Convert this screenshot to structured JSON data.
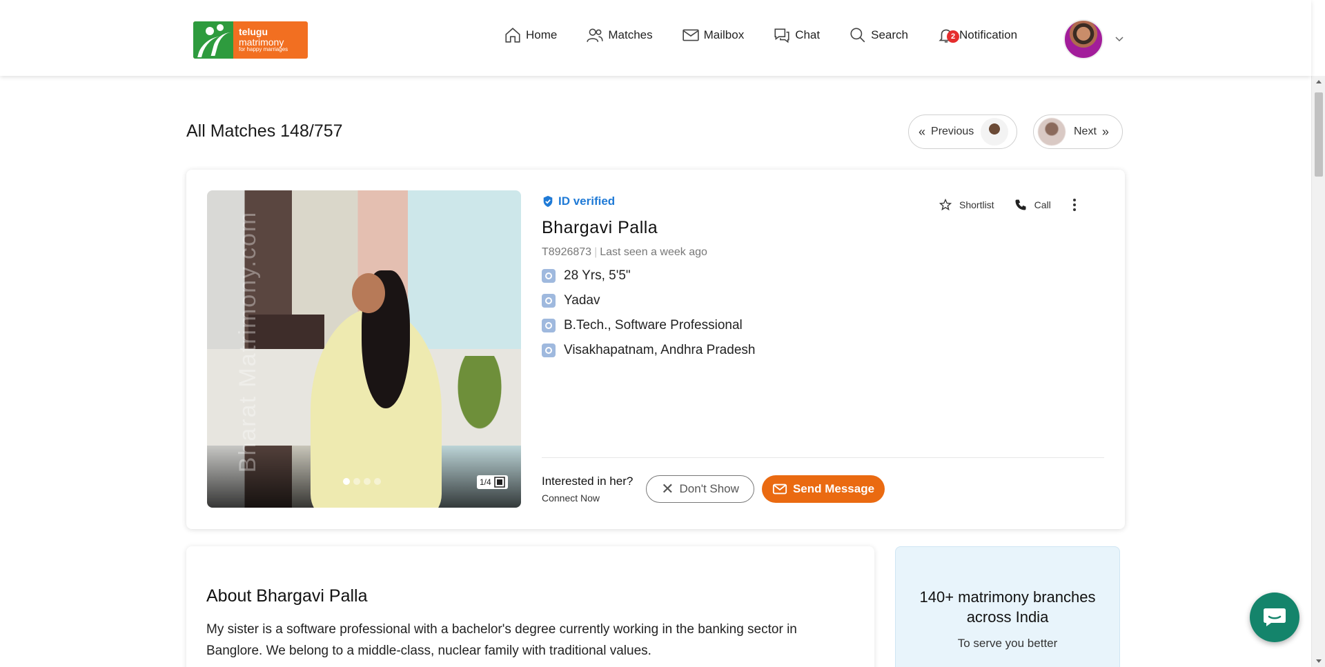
{
  "logo": {
    "line1": "telugu",
    "line2": "matrimony",
    "tagline": "for happy marriages"
  },
  "nav": {
    "home": "Home",
    "matches": "Matches",
    "mailbox": "Mailbox",
    "chat": "Chat",
    "search": "Search",
    "notification": "Notification",
    "notification_count": "2"
  },
  "title": {
    "text": "All Matches 148/757"
  },
  "pager": {
    "previous": "Previous",
    "next": "Next"
  },
  "profile": {
    "verified": "ID verified",
    "name": "Bhargavi Palla",
    "id": "T8926873",
    "last_seen": "Last seen a week ago",
    "details": [
      {
        "icon": "age-icon",
        "text": "28 Yrs, 5'5\""
      },
      {
        "icon": "community-icon",
        "text": "Yadav"
      },
      {
        "icon": "education-icon",
        "text": "B.Tech., Software Professional"
      },
      {
        "icon": "location-icon",
        "text": "Visakhapatnam, Andhra Pradesh"
      }
    ],
    "photo_count": "1/4",
    "photo_watermark": "Bharat Matrimony.com",
    "shortlist": "Shortlist",
    "call": "Call",
    "interested_q": "Interested in her?",
    "connect": "Connect Now",
    "dont_show": "Don't Show",
    "send_message": "Send Message"
  },
  "about": {
    "heading": "About Bhargavi Palla",
    "text": "My sister is a software professional with a bachelor's degree currently working in the banking sector in Banglore. We belong to a middle-class, nuclear family with traditional values."
  },
  "branches": {
    "title": "140+ matrimony branches across India",
    "subtitle": "To serve you better"
  },
  "colors": {
    "accent_orange": "#ea6a11",
    "verified_blue": "#1f7ad6",
    "chat_green": "#14846b"
  }
}
